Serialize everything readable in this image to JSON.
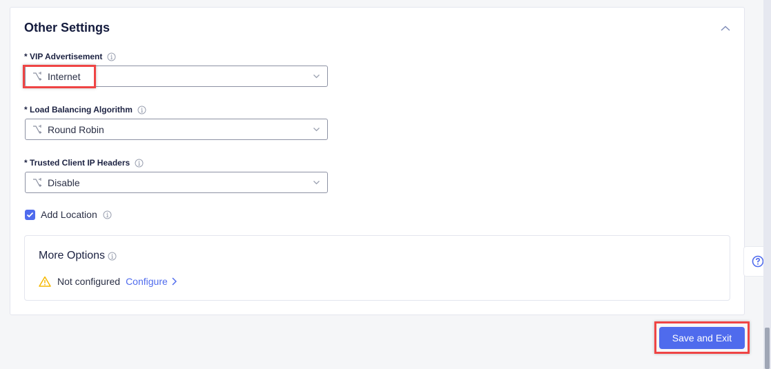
{
  "section": {
    "title": "Other Settings",
    "collapse_icon": "chevron-up-icon"
  },
  "fields": [
    {
      "label": "* VIP Advertisement",
      "value": "Internet",
      "icon": "route-icon"
    },
    {
      "label": "* Load Balancing Algorithm",
      "value": "Round Robin",
      "icon": "route-icon"
    },
    {
      "label": "* Trusted Client IP Headers",
      "value": "Disable",
      "icon": "route-icon"
    }
  ],
  "add_location": {
    "label": "Add Location",
    "checked": true
  },
  "more_options": {
    "title": "More Options",
    "status": "Not configured",
    "link": "Configure"
  },
  "actions": {
    "save_exit": "Save and Exit"
  },
  "help": {
    "icon": "help-circle-icon"
  },
  "colors": {
    "accent": "#4f6bed",
    "warning": "#f5b800",
    "highlight": "#ef4444",
    "title": "#141b3d"
  }
}
